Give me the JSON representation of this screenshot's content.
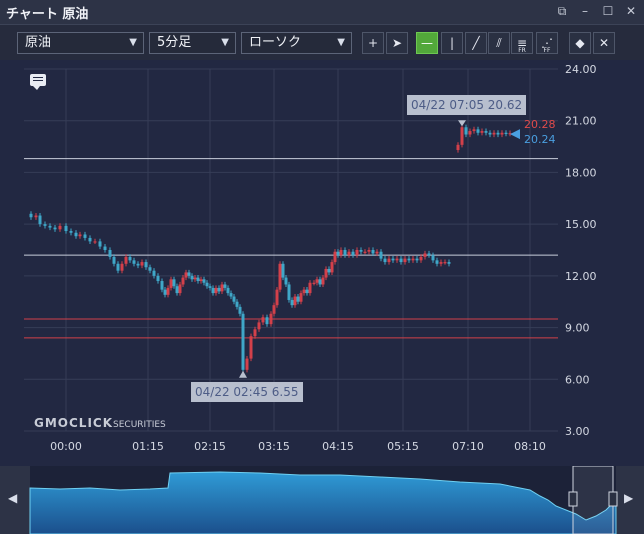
{
  "window": {
    "title": "チャート 原油",
    "icons": [
      "popout-icon",
      "minimize-icon",
      "maximize-icon",
      "close-icon"
    ]
  },
  "toolbar": {
    "symbol": "原油",
    "interval": "5分足",
    "chart_type": "ローソク",
    "tools": [
      {
        "name": "crosshair-tool",
        "glyph": "+"
      },
      {
        "name": "pointer-tool",
        "glyph": "➤"
      },
      {
        "name": "horizontal-line-tool",
        "glyph": "—",
        "active": true
      },
      {
        "name": "vertical-line-tool",
        "glyph": "|"
      },
      {
        "name": "trend-line-tool",
        "glyph": "╱"
      },
      {
        "name": "channel-tool",
        "glyph": "⫽"
      },
      {
        "name": "fibonacci-retracement-tool",
        "glyph": "≡",
        "sub": "FR"
      },
      {
        "name": "fibonacci-fan-tool",
        "glyph": "⋰",
        "sub": "FF"
      },
      {
        "name": "eraser-tool",
        "glyph": "◆"
      },
      {
        "name": "erase-all-tool",
        "glyph": "✕"
      }
    ]
  },
  "chart_data": {
    "type": "candlestick",
    "y_ticks": [
      "24.00",
      "21.00",
      "18.00",
      "15.00",
      "12.00",
      "9.00",
      "6.00",
      "3.00"
    ],
    "ylim": [
      3,
      24
    ],
    "x_ticks": [
      "00:00",
      "01:15",
      "02:15",
      "03:15",
      "04:15",
      "05:15",
      "07:10",
      "08:10"
    ],
    "horizontal_lines": [
      {
        "value": 18.8,
        "color": "#c9cedb"
      },
      {
        "value": 13.2,
        "color": "#c9cedb"
      },
      {
        "value": 9.5,
        "color": "#d3404a"
      },
      {
        "value": 8.4,
        "color": "#d3404a"
      }
    ],
    "up_color": "#d3404a",
    "down_color": "#3fa7c8",
    "last_price_red": "20.28",
    "last_price_blue": "20.24",
    "tooltip_high": "04/22 07:05 20.62",
    "tooltip_low": "04/22 02:45 6.55"
  },
  "watermark": {
    "brand": "GMOCLICK",
    "suffix": "SECURITIES"
  }
}
